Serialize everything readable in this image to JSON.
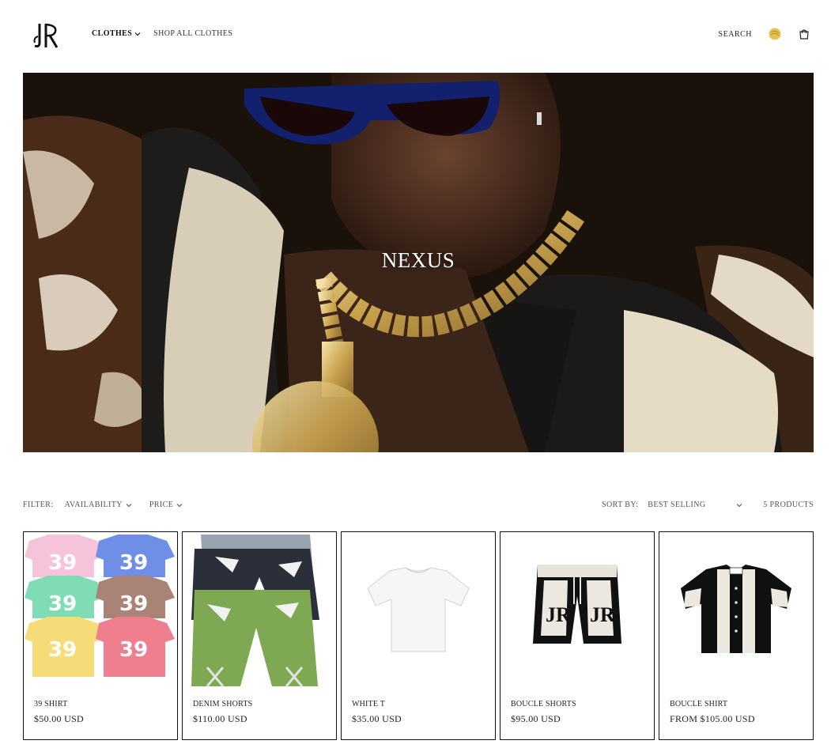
{
  "header": {
    "logo_text": "JR",
    "nav": [
      {
        "label": "CLOTHES",
        "active": true
      },
      {
        "label": "SHOP ALL CLOTHES",
        "active": false
      }
    ],
    "search_label": "SEARCH",
    "icons": {
      "account": "coin-icon",
      "cart": "cart-icon"
    },
    "accent": "#d9b44a"
  },
  "hero": {
    "title": "NEXUS"
  },
  "filters": {
    "filter_label": "FILTER:",
    "availability_label": "AVAILABILITY",
    "price_label": "PRICE",
    "sort_label": "SORT BY:",
    "sort_value": "BEST SELLING",
    "count_label": "5 PRODUCTS"
  },
  "products": [
    {
      "name": "39 SHIRT",
      "price": "$50.00 USD"
    },
    {
      "name": "DENIM SHORTS",
      "price": "$110.00 USD"
    },
    {
      "name": "WHITE T",
      "price": "$35.00 USD"
    },
    {
      "name": "BOUCLE SHORTS",
      "price": "$95.00 USD"
    },
    {
      "name": "BOUCLE SHIRT",
      "price": "FROM $105.00 USD"
    }
  ]
}
